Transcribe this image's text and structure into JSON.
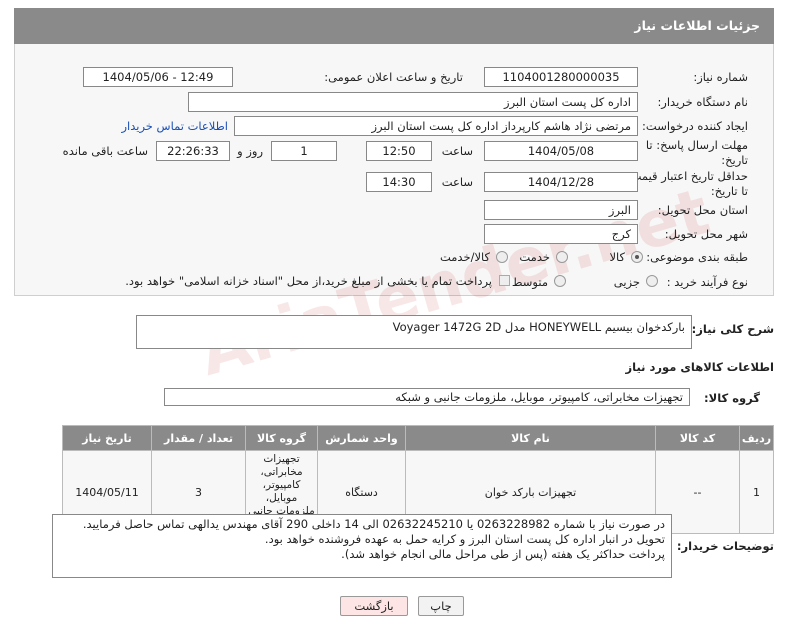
{
  "header": {
    "title": "جزئیات اطلاعات نیاز"
  },
  "form": {
    "need_number_label": "شماره نیاز:",
    "need_number": "1104001280000035",
    "announce_label": "تاریخ و ساعت اعلان عمومی:",
    "announce_value": "1404/05/06 - 12:49",
    "buyer_org_label": "نام دستگاه خریدار:",
    "buyer_org": "اداره کل پست استان البرز",
    "creator_label": "ایجاد کننده درخواست:",
    "creator": "مرتضی  نژاد هاشم کارپرداز اداره کل پست استان البرز",
    "contact_link": "اطلاعات تماس خریدار",
    "reply_deadline_label_1": "مهلت ارسال پاسخ: تا",
    "reply_deadline_label_2": "تاریخ:",
    "reply_date": "1404/05/08",
    "time_label": "ساعت",
    "reply_time": "12:50",
    "days_value": "1",
    "days_label": "روز و",
    "remaining_time": "22:26:33",
    "remaining_label": "ساعت باقی مانده",
    "price_deadline_label_1": "حداقل تاریخ اعتبار قیمت:",
    "price_deadline_label_2": "تا تاریخ:",
    "price_date": "1404/12/28",
    "price_time": "14:30",
    "province_label": "استان محل تحویل:",
    "province": "البرز",
    "city_label": "شهر محل تحویل:",
    "city": "کرج",
    "category_label": "طبقه بندی موضوعی:",
    "category_options": [
      "کالا",
      "خدمت",
      "کالا/خدمت"
    ],
    "purchase_type_label": "نوع فرآیند خرید :",
    "purchase_options": [
      "جزیی",
      "متوسط"
    ],
    "payment_note": "پرداخت تمام یا بخشی از مبلغ خرید،از محل \"اسناد خزانه اسلامی\" خواهد بود."
  },
  "description": {
    "label": "شرح کلی نیاز:",
    "value": "بارکدخوان بیسیم HONEYWELL مدل Voyager 1472G 2D"
  },
  "goods": {
    "section_title": "اطلاعات کالاهای مورد نیاز",
    "group_label": "گروه کالا:",
    "group_value": "تجهیزات مخابراتی، کامپیوتر، موبایل، ملزومات جانبی و شبکه",
    "columns": [
      "ردیف",
      "کد کالا",
      "نام کالا",
      "واحد شمارش",
      "گروه کالا",
      "تعداد / مقدار",
      "تاریخ نیاز"
    ],
    "rows": [
      [
        "1",
        "--",
        "تجهیزات بارکد خوان",
        "دستگاه",
        "تجهیزات مخابراتی، کامپیوتر، موبایل، ملزومات جانبی و شبکه",
        "3",
        "1404/05/11"
      ]
    ]
  },
  "buyer_notes": {
    "label": "توضیحات خریدار:",
    "lines": [
      "در صورت نیاز با شماره 0263228982 یا 02632245210 الی 14 داخلی 290 آقای مهندس یدالهی تماس حاصل فرمایید.",
      "تحویل در  انبار اداره کل پست استان البرز و کرایه حمل به عهده فروشنده خواهد بود.",
      "پرداخت حداکثر یک هفته (پس از طی مراحل مالی انجام خواهد شد)."
    ]
  },
  "buttons": {
    "print": "چاپ",
    "back": "بازگشت"
  },
  "watermark": "AriaTender.net"
}
